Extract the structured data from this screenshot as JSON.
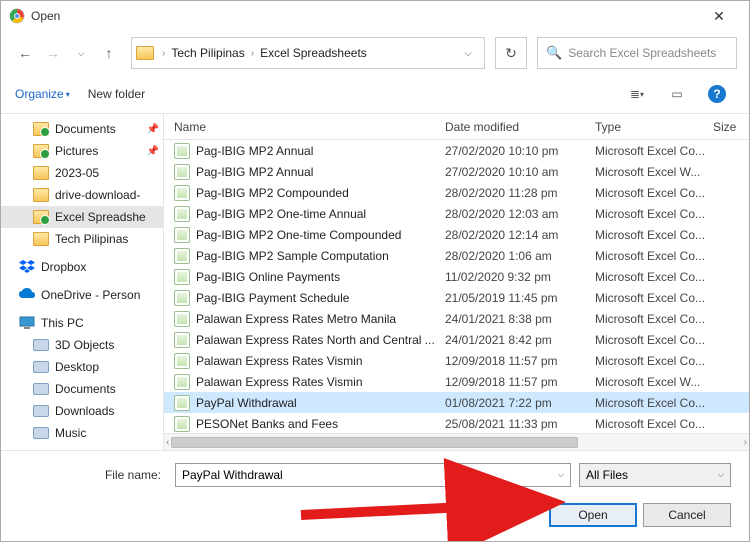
{
  "title": "Open",
  "nav": {
    "crumbs": [
      "Tech Pilipinas",
      "Excel Spreadsheets"
    ],
    "search_placeholder": "Search Excel Spreadsheets"
  },
  "toolbar": {
    "organize": "Organize",
    "new_folder": "New folder"
  },
  "tree": {
    "quick": [
      {
        "label": "Documents",
        "icon": "folder green",
        "pinned": true
      },
      {
        "label": "Pictures",
        "icon": "folder green",
        "pinned": true
      },
      {
        "label": "2023-05",
        "icon": "folder"
      },
      {
        "label": "drive-download-",
        "icon": "folder"
      },
      {
        "label": "Excel Spreadshe",
        "icon": "folder green",
        "selected": true
      },
      {
        "label": "Tech Pilipinas",
        "icon": "folder"
      }
    ],
    "dropbox": "Dropbox",
    "onedrive": "OneDrive - Person",
    "thispc": "This PC",
    "thispc_items": [
      "3D Objects",
      "Desktop",
      "Documents",
      "Downloads",
      "Music"
    ]
  },
  "columns": {
    "name": "Name",
    "date": "Date modified",
    "type": "Type",
    "size": "Size"
  },
  "files": [
    {
      "name": "Pag-IBIG MP2 Annual",
      "date": "27/02/2020 10:10 pm",
      "type": "Microsoft Excel Co..."
    },
    {
      "name": "Pag-IBIG MP2 Annual",
      "date": "27/02/2020 10:10 am",
      "type": "Microsoft Excel W..."
    },
    {
      "name": "Pag-IBIG MP2 Compounded",
      "date": "28/02/2020 11:28 pm",
      "type": "Microsoft Excel Co..."
    },
    {
      "name": "Pag-IBIG MP2 One-time Annual",
      "date": "28/02/2020 12:03 am",
      "type": "Microsoft Excel Co..."
    },
    {
      "name": "Pag-IBIG MP2 One-time Compounded",
      "date": "28/02/2020 12:14 am",
      "type": "Microsoft Excel Co..."
    },
    {
      "name": "Pag-IBIG MP2 Sample Computation",
      "date": "28/02/2020 1:06 am",
      "type": "Microsoft Excel Co..."
    },
    {
      "name": "Pag-IBIG Online Payments",
      "date": "11/02/2020 9:32 pm",
      "type": "Microsoft Excel Co..."
    },
    {
      "name": "Pag-IBIG Payment Schedule",
      "date": "21/05/2019 11:45 pm",
      "type": "Microsoft Excel Co..."
    },
    {
      "name": "Palawan Express Rates Metro Manila",
      "date": "24/01/2021 8:38 pm",
      "type": "Microsoft Excel Co..."
    },
    {
      "name": "Palawan Express Rates North and Central ...",
      "date": "24/01/2021 8:42 pm",
      "type": "Microsoft Excel Co..."
    },
    {
      "name": "Palawan Express Rates Vismin",
      "date": "12/09/2018 11:57 pm",
      "type": "Microsoft Excel Co..."
    },
    {
      "name": "Palawan Express Rates Vismin",
      "date": "12/09/2018 11:57 pm",
      "type": "Microsoft Excel W..."
    },
    {
      "name": "PayPal Withdrawal",
      "date": "01/08/2021 7:22 pm",
      "type": "Microsoft Excel Co...",
      "selected": true
    },
    {
      "name": "PESONet Banks and Fees",
      "date": "25/08/2021 11:33 pm",
      "type": "Microsoft Excel Co..."
    }
  ],
  "footer": {
    "filename_label": "File name:",
    "filename_value": "PayPal Withdrawal",
    "filter": "All Files",
    "open": "Open",
    "cancel": "Cancel"
  }
}
